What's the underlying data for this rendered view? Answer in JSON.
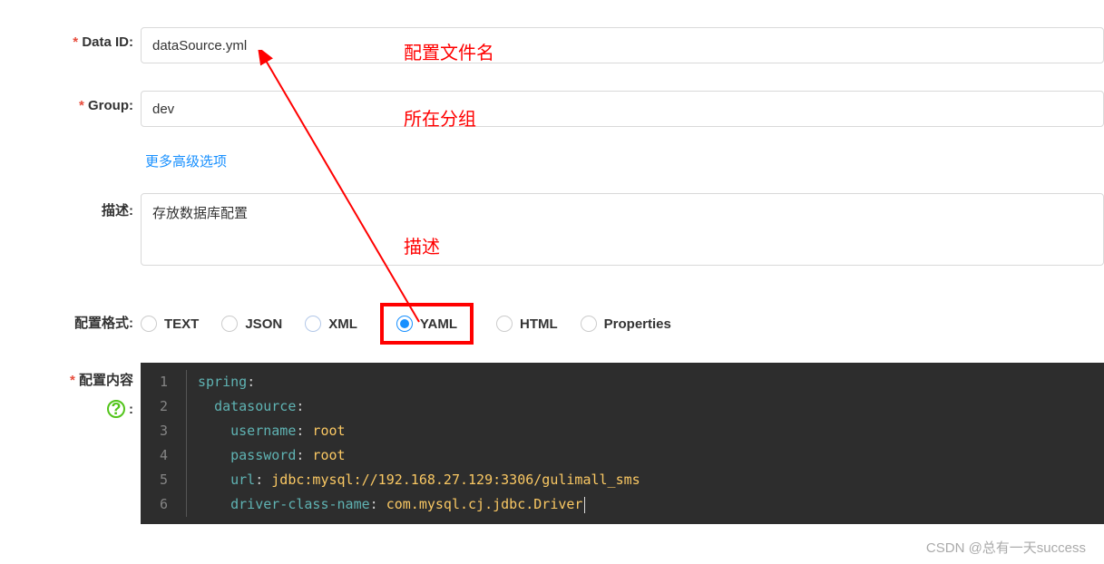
{
  "form": {
    "data_id": {
      "label": "Data ID:",
      "value": "dataSource.yml"
    },
    "group": {
      "label": "Group:",
      "value": "dev"
    },
    "more_options": "更多高级选项",
    "description": {
      "label": "描述:",
      "value": "存放数据库配置"
    },
    "format": {
      "label": "配置格式:",
      "options": [
        "TEXT",
        "JSON",
        "XML",
        "YAML",
        "HTML",
        "Properties"
      ],
      "selected": "YAML"
    },
    "content": {
      "label": "配置内容"
    }
  },
  "annotations": {
    "file_name": "配置文件名",
    "group": "所在分组",
    "description": "描述"
  },
  "code": {
    "lines": [
      {
        "n": "1",
        "indent": "",
        "key": "spring",
        "val": ""
      },
      {
        "n": "2",
        "indent": "  ",
        "key": "datasource",
        "val": ""
      },
      {
        "n": "3",
        "indent": "    ",
        "key": "username",
        "val": " root"
      },
      {
        "n": "4",
        "indent": "    ",
        "key": "password",
        "val": " root"
      },
      {
        "n": "5",
        "indent": "    ",
        "key": "url",
        "val": " jdbc:mysql://192.168.27.129:3306/gulimall_sms"
      },
      {
        "n": "6",
        "indent": "    ",
        "key": "driver-class-name",
        "val": " com.mysql.cj.jdbc.Driver"
      }
    ]
  },
  "help_icon": "?",
  "watermark": "CSDN @总有一天success"
}
